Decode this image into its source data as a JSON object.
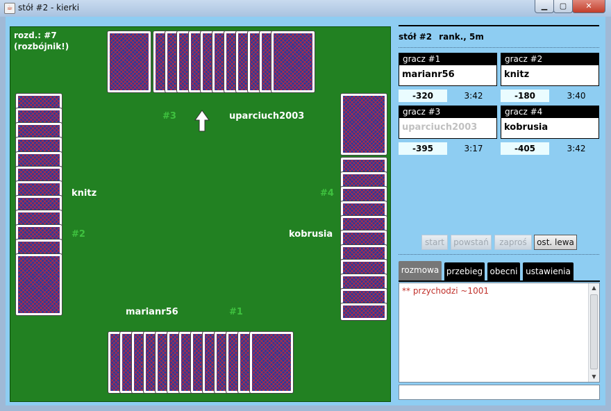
{
  "window": {
    "title": "stół #2 - kierki",
    "minimize_symbol": "▁",
    "maximize_symbol": "▢",
    "close_symbol": "✕",
    "app_icon": "java-coffee-icon"
  },
  "table": {
    "deal_label": "rozd.: #7",
    "deal_mode": "(rozbójnik!)",
    "seats": [
      {
        "number": "#1",
        "name": "marianr56",
        "position": "bottom",
        "cards": 16
      },
      {
        "number": "#2",
        "name": "knitz",
        "position": "left",
        "cards": 12
      },
      {
        "number": "#3",
        "name": "uparciuch2003",
        "position": "top",
        "cards": 15
      },
      {
        "number": "#4",
        "name": "kobrusia",
        "position": "right",
        "cards": 12
      }
    ],
    "turn_arrow_icon": "arrow-up-icon"
  },
  "panel": {
    "table_name": "stół #2",
    "table_info": "rank., 5m",
    "players": [
      {
        "header": "gracz #1",
        "name": "marianr56",
        "score": "-320",
        "time": "3:42",
        "present": true
      },
      {
        "header": "gracz #2",
        "name": "knitz",
        "score": "-180",
        "time": "3:40",
        "present": true
      },
      {
        "header": "gracz #3",
        "name": "uparciuch2003",
        "score": "-395",
        "time": "3:17",
        "present": false
      },
      {
        "header": "gracz #4",
        "name": "kobrusia",
        "score": "-405",
        "time": "3:42",
        "present": true
      }
    ],
    "buttons": [
      "start",
      "powstań",
      "zaproś",
      "ost. lewa"
    ],
    "tabs": [
      "rozmowa",
      "przebieg",
      "obecni",
      "ustawienia"
    ],
    "chat_messages": [
      "** przychodzi ~1001"
    ],
    "chat_input_value": ""
  },
  "colors": {
    "felt": "#228122",
    "panel_bg": "#8ecdf2",
    "seat_number": "#3fc23f",
    "chat_system_text": "#c0302a"
  }
}
